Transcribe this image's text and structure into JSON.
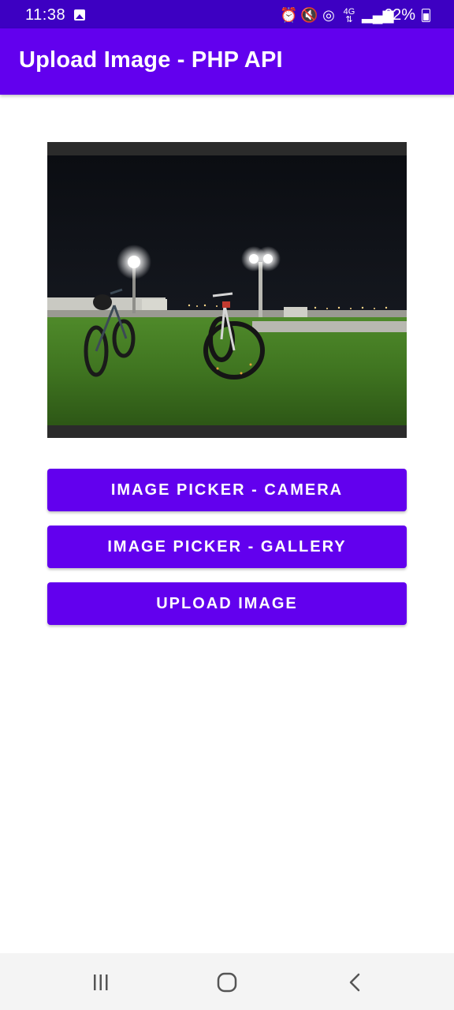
{
  "status_bar": {
    "time": "11:38",
    "battery": "62%",
    "icons": [
      "gallery-icon",
      "alarm-icon",
      "mute-icon",
      "hotspot-icon",
      "4g-icon",
      "signal-icon",
      "battery-icon"
    ]
  },
  "app_bar": {
    "title": "Upload Image - PHP API",
    "color": "#6200ee"
  },
  "preview": {
    "description_icon": "image-preview"
  },
  "buttons": {
    "camera": "IMAGE PICKER - CAMERA",
    "gallery": "IMAGE PICKER - GALLERY",
    "upload": "UPLOAD IMAGE"
  },
  "nav_bar": {
    "icons": [
      "recents-icon",
      "home-icon",
      "back-icon"
    ]
  },
  "colors": {
    "status_bar": "#3d00c2",
    "primary": "#6200ee"
  }
}
